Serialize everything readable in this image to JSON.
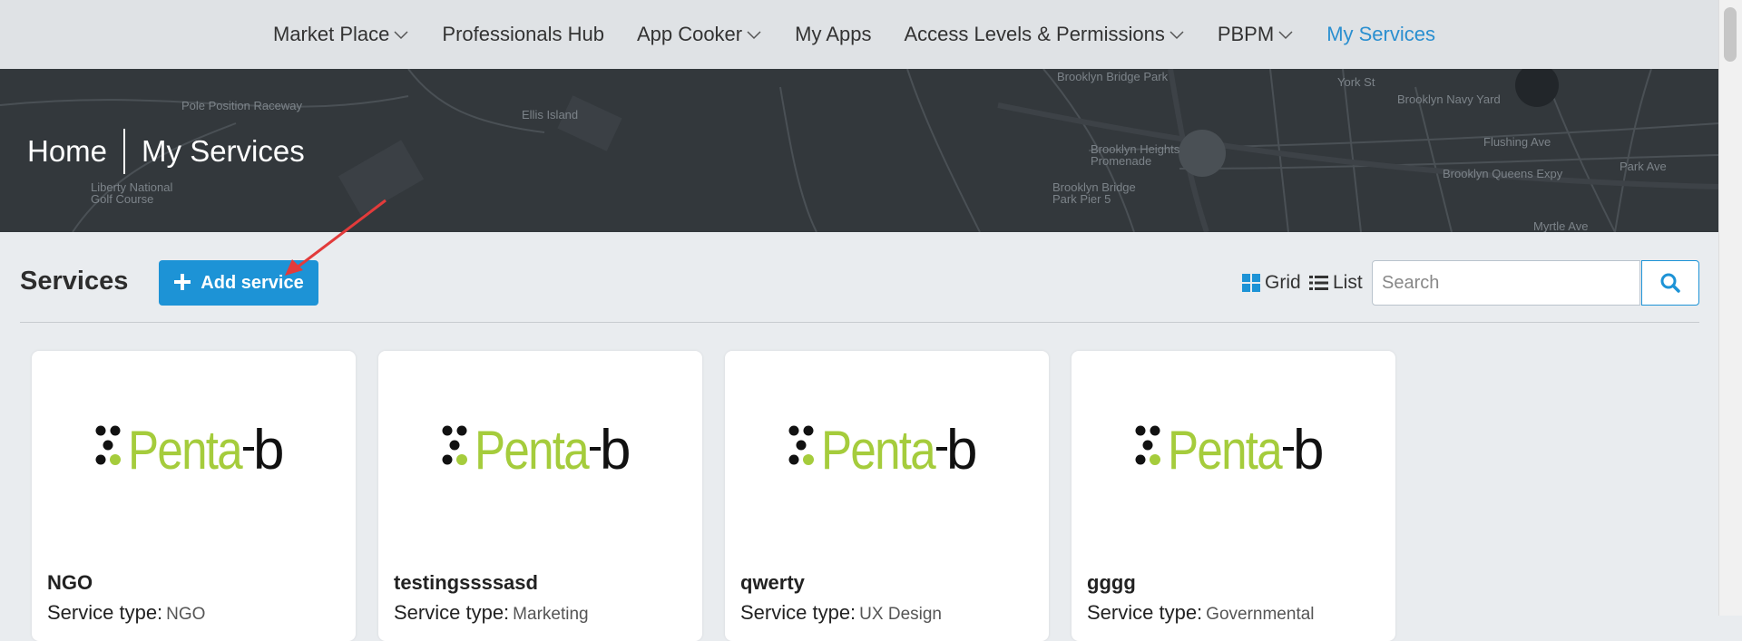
{
  "nav": {
    "items": [
      {
        "label": "Market Place",
        "dropdown": true
      },
      {
        "label": "Professionals Hub",
        "dropdown": false
      },
      {
        "label": "App Cooker",
        "dropdown": true
      },
      {
        "label": "My Apps",
        "dropdown": false
      },
      {
        "label": "Access Levels & Permissions",
        "dropdown": true
      },
      {
        "label": "PBPM",
        "dropdown": true
      },
      {
        "label": "My Services",
        "dropdown": false,
        "active": true
      }
    ],
    "active_color": "#2a8fd0"
  },
  "hero": {
    "breadcrumb": {
      "home": "Home",
      "current": "My Services"
    },
    "map_labels": [
      "Pole Position Raceway",
      "Ellis Island",
      "Brooklyn Bridge Park",
      "York St",
      "Brooklyn Navy Yard",
      "Brooklyn Heights Promenade",
      "Brooklyn Bridge Park Pier 5",
      "Flushing Ave",
      "Brooklyn Queens Expy",
      "Park Ave",
      "Liberty National Golf Course",
      "Myrtle Ave"
    ]
  },
  "toolbar": {
    "title": "Services",
    "add_label": "Add service",
    "grid_label": "Grid",
    "list_label": "List",
    "search_placeholder": "Search"
  },
  "services": [
    {
      "name": "NGO",
      "type_label": "Service type:",
      "type_value": "NGO",
      "logo": "Penta-b"
    },
    {
      "name": "testingssssasd",
      "type_label": "Service type:",
      "type_value": "Marketing",
      "logo": "Penta-b"
    },
    {
      "name": "qwerty",
      "type_label": "Service type:",
      "type_value": "UX Design",
      "logo": "Penta-b"
    },
    {
      "name": "gggg",
      "type_label": "Service type:",
      "type_value": "Governmental",
      "logo": "Penta-b"
    }
  ],
  "colors": {
    "accent": "#1d93d6",
    "logo_green": "#a5cc3c",
    "hero_bg": "#33383c",
    "annotation_arrow": "#e23b3b"
  },
  "icons": [
    "chevron-down-icon",
    "plus-icon",
    "grid-icon",
    "list-icon",
    "search-icon",
    "annotation-arrow"
  ]
}
